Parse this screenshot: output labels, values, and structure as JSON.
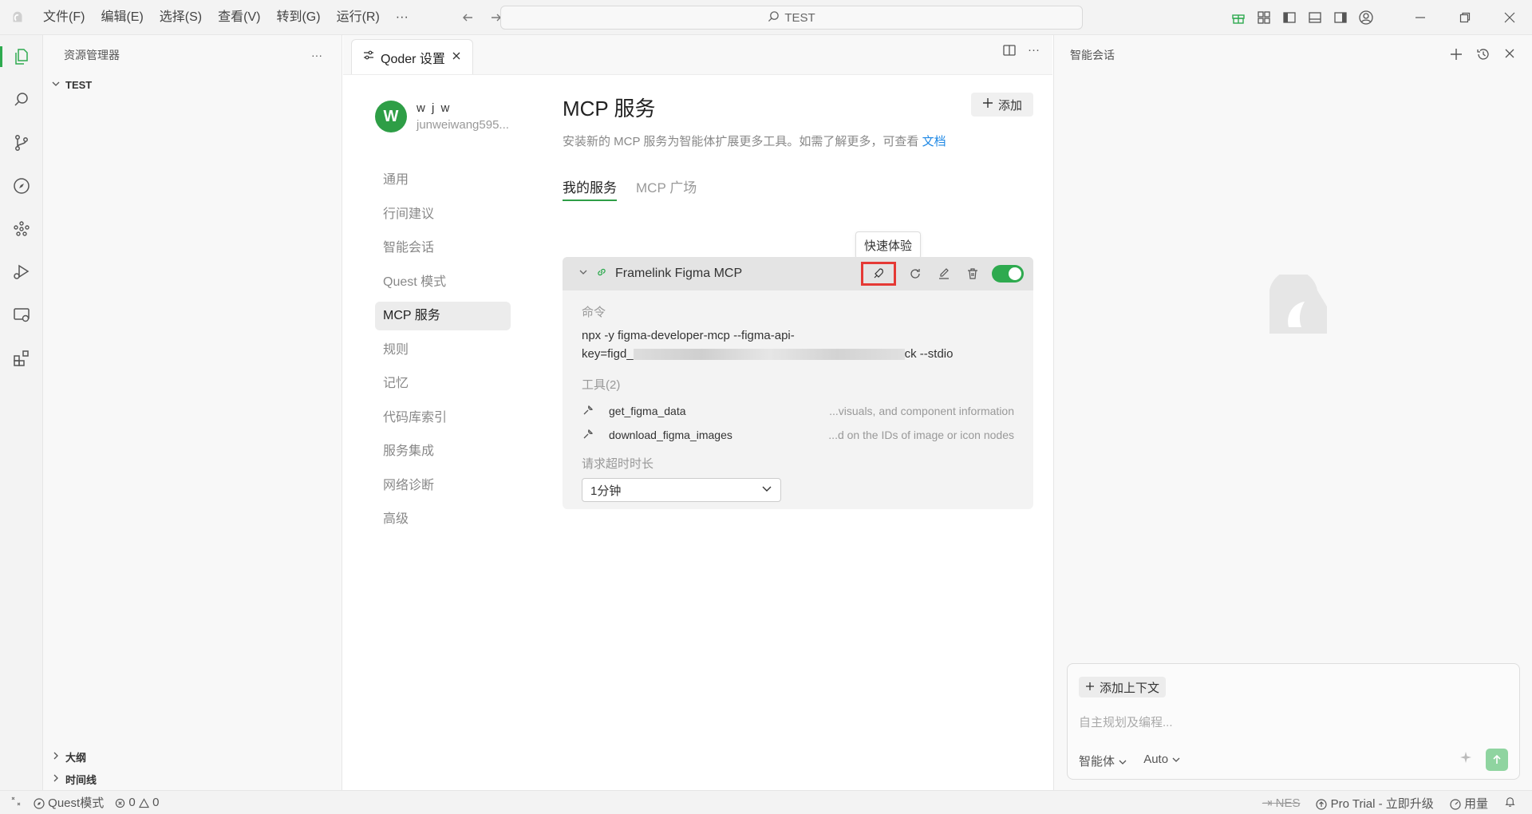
{
  "titlebar": {
    "menu": [
      "文件(F)",
      "编辑(E)",
      "选择(S)",
      "查看(V)",
      "转到(G)",
      "运行(R)",
      "···"
    ],
    "search_text": "TEST"
  },
  "explorer": {
    "title": "资源管理器",
    "more": "···",
    "root": "TEST",
    "outline": "大纲",
    "timeline": "时间线"
  },
  "editor": {
    "tab_label": "Qoder 设置",
    "more": "···"
  },
  "profile": {
    "initial": "W",
    "name": "w j w",
    "email": "junweiwang595..."
  },
  "settings_nav": [
    "通用",
    "行间建议",
    "智能会话",
    "Quest 模式",
    "MCP 服务",
    "规则",
    "记忆",
    "代码库索引",
    "服务集成",
    "网络诊断",
    "高级"
  ],
  "mcp": {
    "title": "MCP 服务",
    "description": "安装新的 MCP 服务为智能体扩展更多工具。如需了解更多，可查看",
    "doc_link": "文档",
    "add_label": "添加",
    "tabs": [
      "我的服务",
      "MCP 广场"
    ],
    "tooltip": "快速体验",
    "server": {
      "name": "Framelink Figma MCP",
      "enabled": true,
      "command_label": "命令",
      "command_line1": "npx -y figma-developer-mcp --figma-api-",
      "command_prefix": "key=figd_",
      "command_suffix": "ck --stdio",
      "tools_label": "工具(2)",
      "tools": [
        {
          "name": "get_figma_data",
          "desc": "...visuals, and component information"
        },
        {
          "name": "download_figma_images",
          "desc": "...d on the IDs of image or icon nodes"
        }
      ],
      "timeout_label": "请求超时时长",
      "timeout_value": "1分钟"
    }
  },
  "chat": {
    "title": "智能会话",
    "add_context": "添加上下文",
    "placeholder": "自主规划及编程...",
    "agent_mode": "智能体",
    "model": "Auto"
  },
  "statusbar": {
    "quest_mode": "Quest模式",
    "errors": "0",
    "warnings": "0",
    "nes": "NES",
    "pro_trial": "Pro Trial - 立即升级",
    "usage": "用量"
  },
  "colors": {
    "accent": "#2eaa4f",
    "highlight": "#e53935",
    "link": "#1e88e5"
  }
}
